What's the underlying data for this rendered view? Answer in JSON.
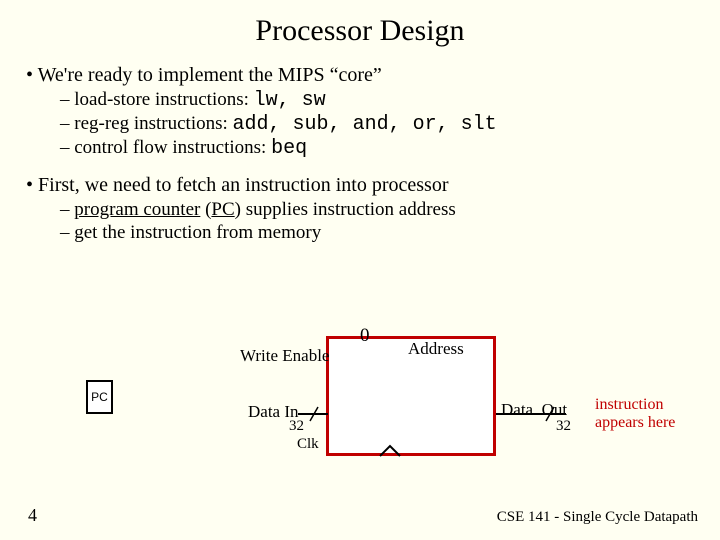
{
  "title": "Processor Design",
  "bullets": [
    {
      "text": "We're ready to implement the MIPS  “core”",
      "subs": [
        {
          "label": "load-store instructions:  ",
          "mono": "lw, sw",
          "type": "plain"
        },
        {
          "label": "reg-reg instructions:  ",
          "mono": "add, sub, and, or, slt",
          "type": "plain"
        },
        {
          "label": "control flow instructions:  ",
          "mono": "beq",
          "type": "plain"
        }
      ]
    },
    {
      "text": "First, we need to fetch an instruction into processor",
      "subs": [
        {
          "prefix": "program counter",
          "paren_u": "PC",
          "suffix": " supplies instruction address",
          "type": "pc"
        },
        {
          "label": "get the instruction from memory",
          "mono": "",
          "type": "plain"
        }
      ]
    }
  ],
  "diagram": {
    "pc": "PC",
    "write_enable": "Write Enable",
    "zero": "0",
    "address": "Address",
    "data_in": "Data In",
    "data_out": "Data. Out",
    "bits_in": "32",
    "bits_out": "32",
    "clk": "Clk",
    "note_line1": "instruction",
    "note_line2": "appears here"
  },
  "page_number": "4",
  "footer": "CSE 141 - Single Cycle Datapath"
}
